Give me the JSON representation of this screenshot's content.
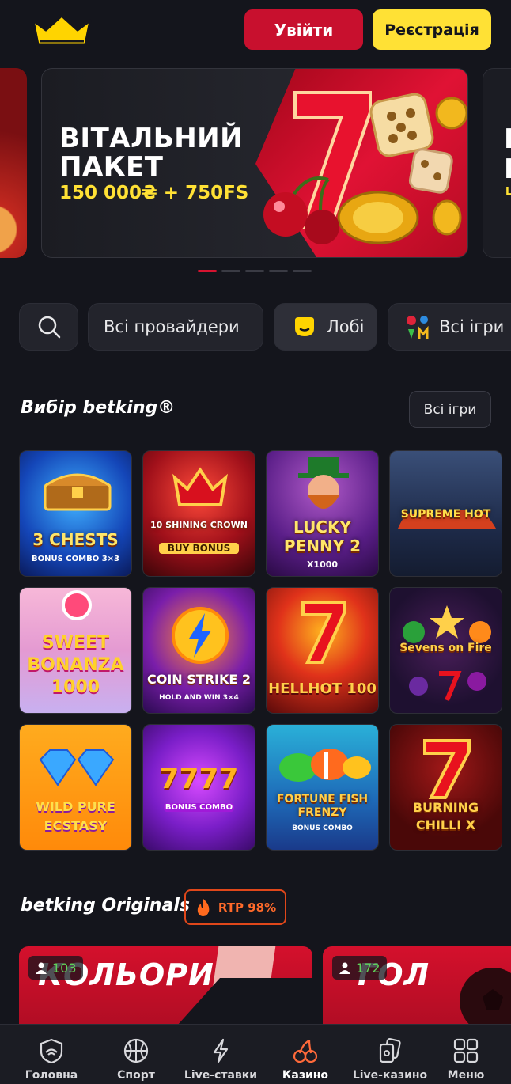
{
  "header": {
    "login_label": "Увійти",
    "register_label": "Реєстрація"
  },
  "banner": {
    "title_line1": "ВІТАЛЬНИЙ",
    "title_line2": "ПАКЕТ",
    "subtitle": "150 000₴ + 750FS",
    "peek_text": "ВІ\nПА",
    "slides": 5,
    "active_slide": 1
  },
  "filters": {
    "providers_label": "Всі провайдери",
    "lobby_label": "Лобі",
    "all_games_label": "Всі ігри"
  },
  "picks": {
    "title": "Вибір betking®",
    "all_games_button": "Всі ігри",
    "games": [
      {
        "name": "3 CHESTS",
        "sub": "BONUS COMBO 3×3"
      },
      {
        "name": "10 SHINING CROWN",
        "sub": "BUY BONUS"
      },
      {
        "name": "LUCKY PENNY 2",
        "sub": "X1000"
      },
      {
        "name": "SUPREME HOT",
        "sub": ""
      },
      {
        "name": "SWEET BONANZA 1000",
        "sub": ""
      },
      {
        "name": "COIN STRIKE 2",
        "sub": "HOLD AND WIN 3×4"
      },
      {
        "name": "HELLHOT 100",
        "sub": ""
      },
      {
        "name": "Sevens on Fire",
        "sub": ""
      },
      {
        "name": "WILD PURE ECSTASY",
        "sub": ""
      },
      {
        "name": "7777",
        "sub": "BONUS COMBO"
      },
      {
        "name": "FORTUNE FISH FRENZY",
        "sub": "BONUS COMBO"
      },
      {
        "name": "BURNING CHILLI X",
        "sub": ""
      }
    ]
  },
  "originals": {
    "title": "betking Originals",
    "rtp_label": "RTP 98%",
    "cards": [
      {
        "title": "КОЛЬОРИ",
        "players": "103"
      },
      {
        "title": "ГОЛ",
        "players": "172"
      }
    ]
  },
  "nav": {
    "items": [
      {
        "label": "Головна",
        "icon": "home-shield-icon"
      },
      {
        "label": "Спорт",
        "icon": "basketball-icon"
      },
      {
        "label": "Live-ставки",
        "icon": "lightning-icon"
      },
      {
        "label": "Казино",
        "icon": "cherries-icon"
      },
      {
        "label": "Live-казино",
        "icon": "cards-icon"
      },
      {
        "label": "Меню",
        "icon": "grid-icon"
      }
    ],
    "active": "Казино"
  },
  "colors": {
    "accent_red": "#c8102e",
    "accent_yellow": "#ffe135",
    "background": "#14151c"
  }
}
